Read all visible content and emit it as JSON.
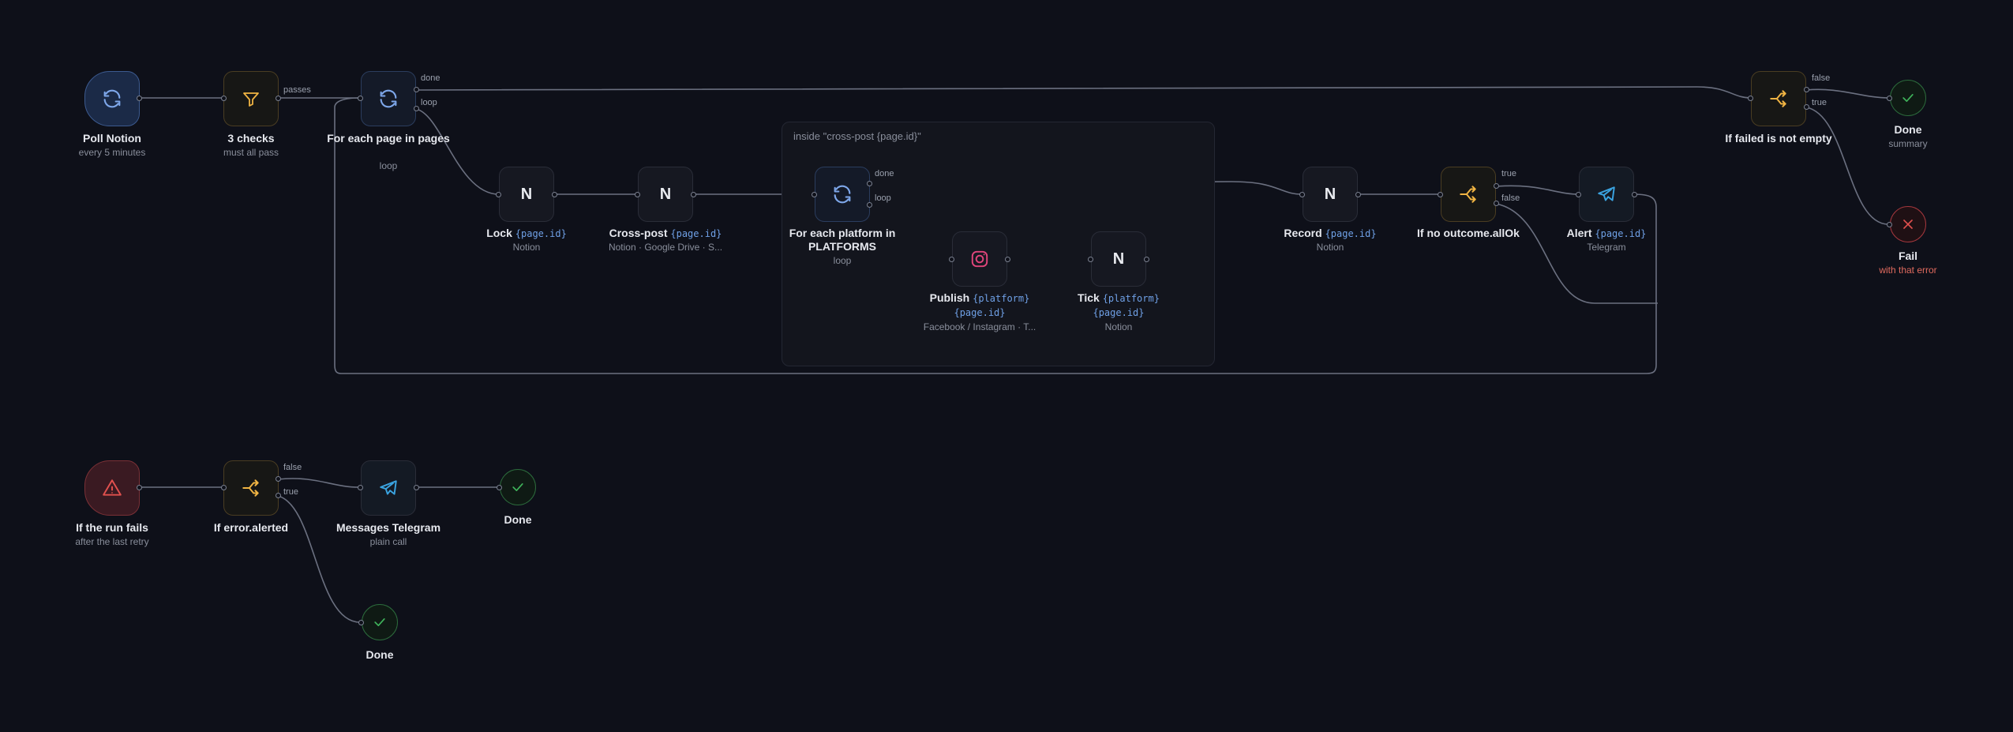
{
  "group": {
    "label": "inside \"cross-post {page.id}\""
  },
  "nodes": {
    "poll": {
      "title": "Poll Notion",
      "sub": "every 5 minutes"
    },
    "checks": {
      "title": "3 checks",
      "sub": "must all pass"
    },
    "foreach_page": {
      "title": "For each page in pages",
      "sub": "loop"
    },
    "lock": {
      "title": "Lock",
      "code": "{page.id}",
      "sub": "Notion"
    },
    "crosspost": {
      "title": "Cross-post",
      "code": "{page.id}",
      "sub": "Notion · Google Drive · S..."
    },
    "foreach_platform": {
      "title": "For each platform in PLATFORMS",
      "sub": "loop"
    },
    "publish": {
      "title": "Publish",
      "code": "{platform} {page.id}",
      "sub": "Facebook / Instagram · T..."
    },
    "tick": {
      "title": "Tick",
      "code": "{platform} {page.id}",
      "sub": "Notion"
    },
    "record": {
      "title": "Record",
      "code": "{page.id}",
      "sub": "Notion"
    },
    "if_no_outcome": {
      "title": "If no outcome.allOk"
    },
    "alert": {
      "title": "Alert",
      "code": "{page.id}",
      "sub": "Telegram"
    },
    "if_failed": {
      "title": "If failed is not empty"
    },
    "done_top": {
      "title": "Done",
      "sub": "summary"
    },
    "fail_top": {
      "title": "Fail",
      "sub": "with that error"
    },
    "run_fails": {
      "title": "If the run fails",
      "sub": "after the last retry"
    },
    "if_alerted": {
      "title": "If error.alerted"
    },
    "msg_tg": {
      "title": "Messages Telegram",
      "sub": "plain call"
    },
    "done_b1": {
      "title": "Done"
    },
    "done_b2": {
      "title": "Done"
    }
  },
  "edge_labels": {
    "passes": "passes",
    "done1": "done",
    "loop1": "loop",
    "done2": "done",
    "loop2": "loop",
    "true1": "true",
    "false1": "false",
    "false2": "false",
    "true2": "true",
    "false3": "false",
    "true3": "true"
  },
  "icons": {
    "poll": "refresh-icon",
    "checks": "filter-icon",
    "foreach_page": "loop-icon",
    "lock": "notion-icon",
    "crosspost": "notion-icon",
    "foreach_platform": "loop-icon",
    "publish": "instagram-icon",
    "tick": "notion-icon",
    "record": "notion-icon",
    "if_no_outcome": "branch-icon",
    "alert": "telegram-icon",
    "if_failed": "branch-icon",
    "done": "check-icon",
    "fail": "close-icon",
    "run_fails": "warning-icon",
    "msg_tg": "telegram-icon"
  },
  "colors": {
    "background": "#0e1019",
    "edge": "#6b7080",
    "loop_accent": "#6fa0e6",
    "logic_accent": "#f0b443",
    "telegram": "#3aa3e0",
    "instagram": "#e0457b",
    "done": "#3fb45b",
    "fail": "#e0504e"
  }
}
